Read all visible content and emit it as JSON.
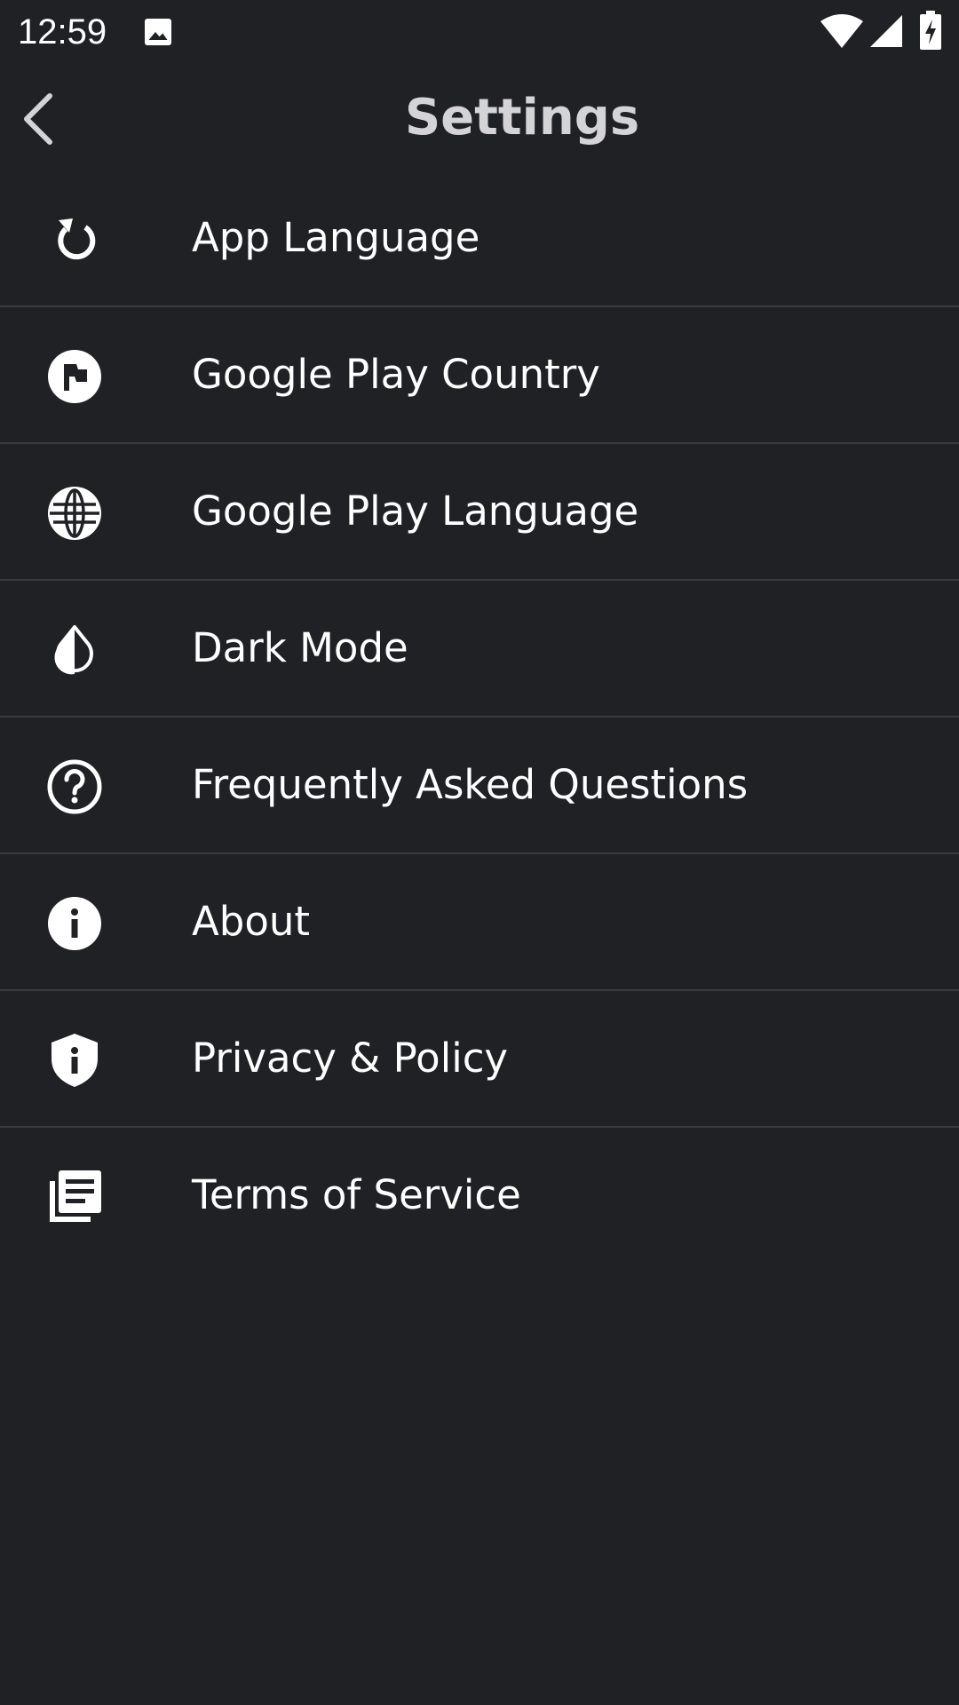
{
  "status_bar": {
    "time": "12:59",
    "icons": [
      "image-icon",
      "wifi-icon",
      "signal-icon",
      "battery-charging-icon"
    ]
  },
  "header": {
    "title": "Settings",
    "back_icon": "chevron-left-icon"
  },
  "settings": {
    "items": [
      {
        "label": "App Language",
        "icon": "refresh-icon"
      },
      {
        "label": "Google Play Country",
        "icon": "flag-icon"
      },
      {
        "label": "Google Play Language",
        "icon": "globe-icon"
      },
      {
        "label": "Dark Mode",
        "icon": "contrast-drop-icon"
      },
      {
        "label": "Frequently Asked Questions",
        "icon": "help-circle-icon"
      },
      {
        "label": "About",
        "icon": "info-icon"
      },
      {
        "label": "Privacy & Policy",
        "icon": "shield-icon"
      },
      {
        "label": "Terms of Service",
        "icon": "document-stack-icon"
      }
    ]
  },
  "colors": {
    "background": "#202125",
    "divider": "#3a3b3f",
    "title": "#d4d4d6",
    "text": "#ffffff"
  }
}
